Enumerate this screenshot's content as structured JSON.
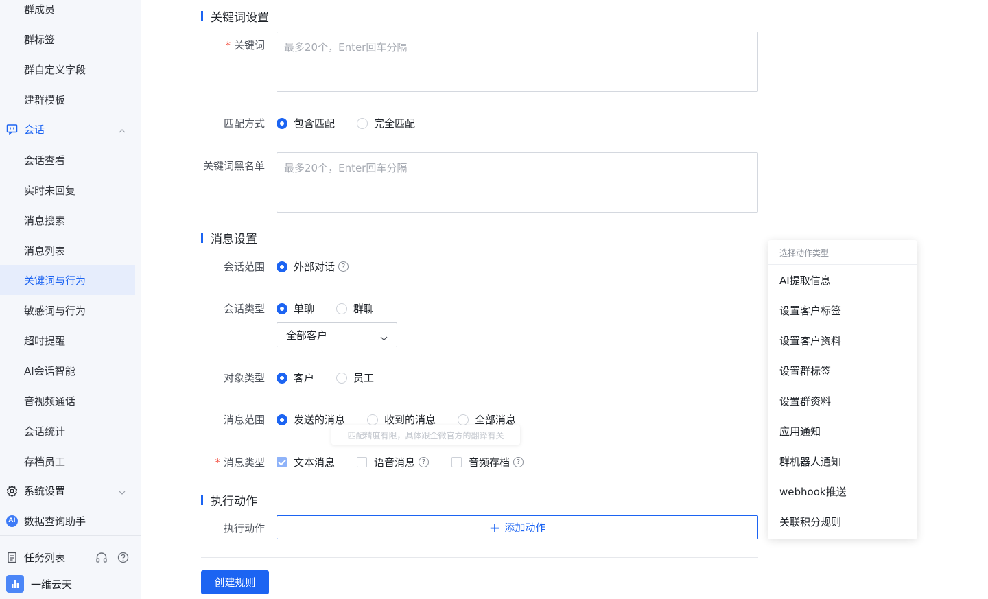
{
  "sidebar": {
    "items_top": [
      {
        "label": "群成员"
      },
      {
        "label": "群标签"
      },
      {
        "label": "群自定义字段"
      },
      {
        "label": "建群模板"
      }
    ],
    "session_group": {
      "label": "会话"
    },
    "session_items": [
      {
        "label": "会话查看"
      },
      {
        "label": "实时未回复"
      },
      {
        "label": "消息搜索"
      },
      {
        "label": "消息列表"
      },
      {
        "label": "关键词与行为"
      },
      {
        "label": "敏感词与行为"
      },
      {
        "label": "超时提醒"
      },
      {
        "label": "AI会话智能"
      },
      {
        "label": "音视频通话"
      },
      {
        "label": "会话统计"
      },
      {
        "label": "存档员工"
      }
    ],
    "system_group": {
      "label": "系统设置"
    },
    "data_assistant": {
      "label": "数据查询助手",
      "badge": "AI"
    },
    "task_list": {
      "label": "任务列表"
    },
    "org_name": "一维云天",
    "accent_color": "#1c64f2"
  },
  "form": {
    "keyword_section": {
      "title": "关键词设置"
    },
    "keyword": {
      "label": "关键词",
      "required": "*",
      "placeholder": "最多20个，Enter回车分隔"
    },
    "match_mode": {
      "label": "匹配方式",
      "options": [
        "包含匹配",
        "完全匹配"
      ],
      "selected": "包含匹配"
    },
    "blacklist": {
      "label": "关键词黑名单",
      "placeholder": "最多20个，Enter回车分隔"
    },
    "message_section": {
      "title": "消息设置"
    },
    "session_scope": {
      "label": "会话范围",
      "options": [
        "外部对话"
      ],
      "selected": "外部对话",
      "help": "?"
    },
    "session_type": {
      "label": "会话类型",
      "options": [
        "单聊",
        "群聊"
      ],
      "selected": "单聊",
      "select_value": "全部客户"
    },
    "object_type": {
      "label": "对象类型",
      "options": [
        "客户",
        "员工"
      ],
      "selected": "客户"
    },
    "message_scope": {
      "label": "消息范围",
      "options": [
        "发送的消息",
        "收到的消息",
        "全部消息"
      ],
      "selected": "发送的消息",
      "tooltip": "匹配精度有限，具体跟企微官方的翻译有关"
    },
    "message_type": {
      "label": "消息类型",
      "required": "*",
      "options": [
        "文本消息",
        "语音消息",
        "音频存档"
      ],
      "checked": [
        "文本消息"
      ]
    },
    "action_section": {
      "title": "执行动作"
    },
    "action": {
      "label": "执行动作",
      "add_button": "添加动作",
      "plus": "+"
    },
    "create_button": "创建规则"
  },
  "action_dropdown": {
    "header": "选择动作类型",
    "items": [
      "AI提取信息",
      "设置客户标签",
      "设置客户资料",
      "设置群标签",
      "设置群资料",
      "应用通知",
      "群机器人通知",
      "webhook推送",
      "关联积分规则"
    ]
  }
}
